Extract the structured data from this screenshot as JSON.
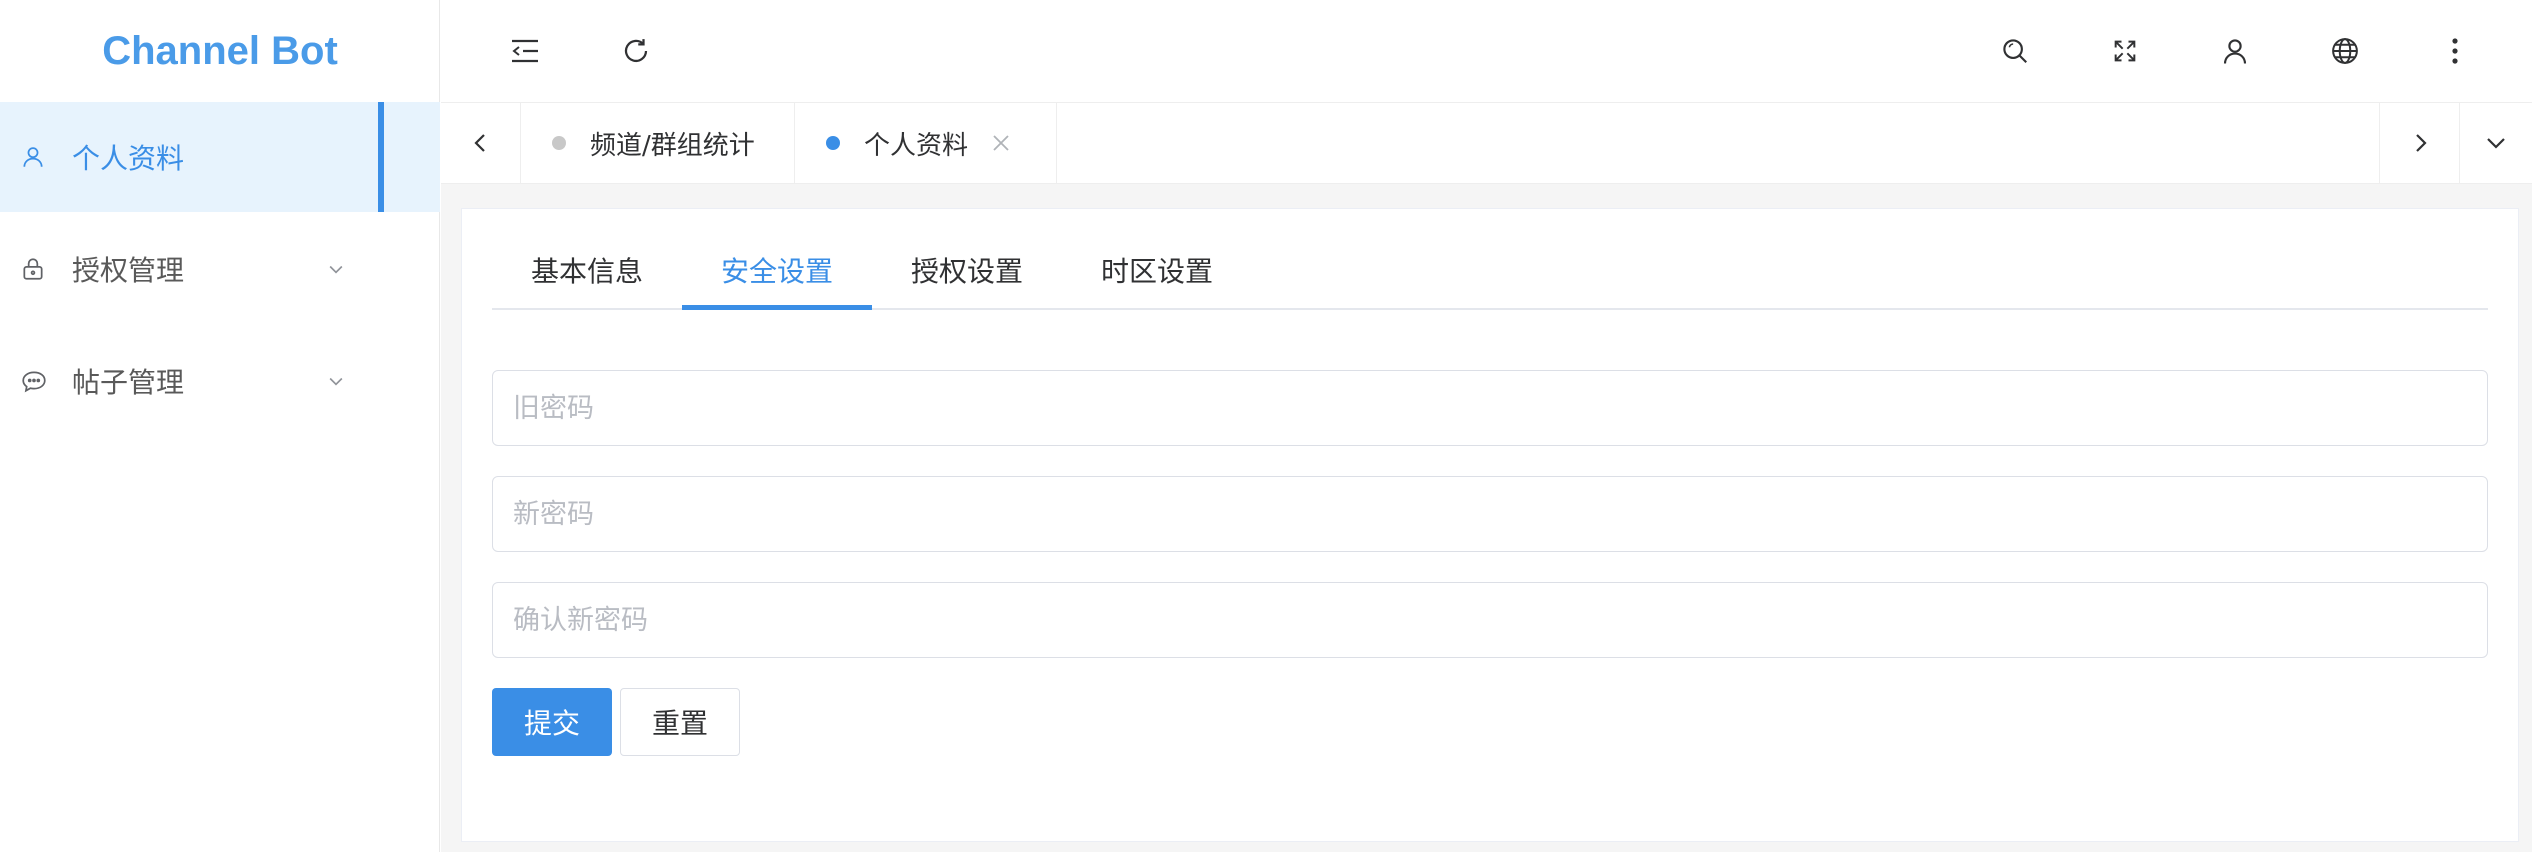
{
  "app": {
    "brand": "Channel Bot"
  },
  "sidebar": {
    "items": [
      {
        "label": "个人资料",
        "icon": "user-icon",
        "active": true
      },
      {
        "label": "授权管理",
        "icon": "lock-icon",
        "has_children": true
      },
      {
        "label": "帖子管理",
        "icon": "chat-icon",
        "has_children": true
      }
    ]
  },
  "header": {
    "left_icons": [
      "menu-fold-icon",
      "refresh-icon"
    ],
    "right_icons": [
      "search-icon",
      "fullscreen-icon",
      "user-icon",
      "globe-icon",
      "more-vertical-icon"
    ]
  },
  "tabs": [
    {
      "label": "频道/群组统计",
      "active": false
    },
    {
      "label": "个人资料",
      "active": true,
      "closable": true
    }
  ],
  "profile": {
    "tabs": [
      "基本信息",
      "安全设置",
      "授权设置",
      "时区设置"
    ],
    "active_tab": "安全设置",
    "form": {
      "old_password": {
        "value": "",
        "placeholder": "旧密码"
      },
      "new_password": {
        "value": "",
        "placeholder": "新密码"
      },
      "confirm_password": {
        "value": "",
        "placeholder": "确认新密码"
      },
      "submit_label": "提交",
      "reset_label": "重置"
    }
  },
  "colors": {
    "accent": "#3a8ee6",
    "brand": "#4a9be8",
    "active_bg": "#e7f3fd",
    "content_bg": "#f5f5f5",
    "inactive_dot": "#c8c8c8"
  }
}
